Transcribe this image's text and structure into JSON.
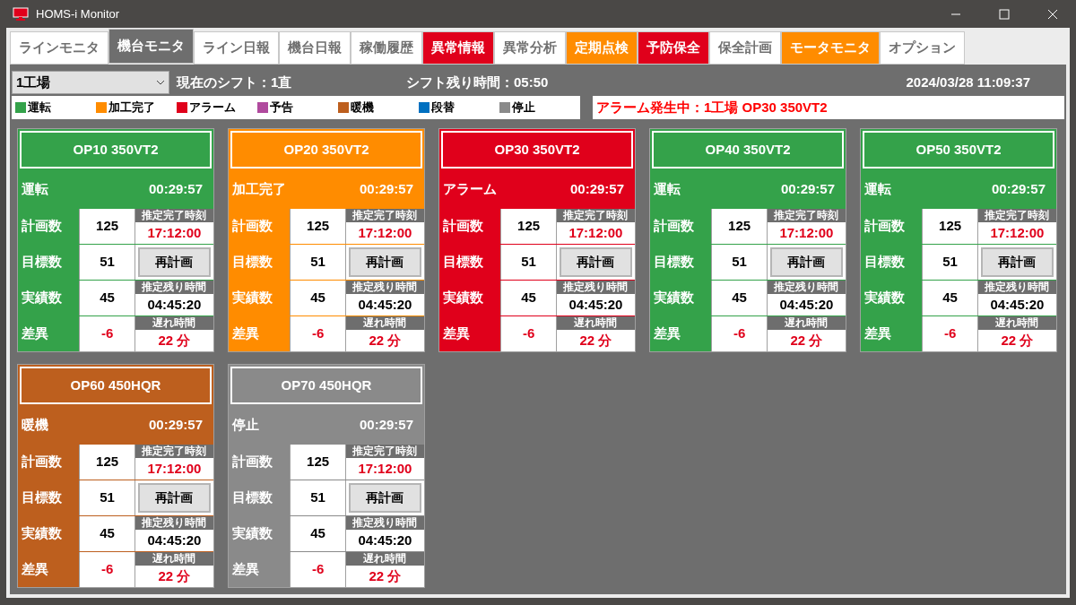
{
  "window": {
    "title": "HOMS-i Monitor"
  },
  "tabs": [
    {
      "label": "ラインモニタ",
      "selected": false,
      "color": "#ffffff"
    },
    {
      "label": "機台モニタ",
      "selected": true,
      "color": "#6e6e6e"
    },
    {
      "label": "ライン日報",
      "selected": false,
      "color": "#ffffff"
    },
    {
      "label": "機台日報",
      "selected": false,
      "color": "#ffffff"
    },
    {
      "label": "稼働履歴",
      "selected": false,
      "color": "#ffffff"
    },
    {
      "label": "異常情報",
      "selected": false,
      "color": "#e0001b"
    },
    {
      "label": "異常分析",
      "selected": false,
      "color": "#ffffff"
    },
    {
      "label": "定期点検",
      "selected": false,
      "color": "#ff8c00"
    },
    {
      "label": "予防保全",
      "selected": false,
      "color": "#e0001b"
    },
    {
      "label": "保全計画",
      "selected": false,
      "color": "#ffffff"
    },
    {
      "label": "モータモニタ",
      "selected": false,
      "color": "#ff8c00"
    },
    {
      "label": "オプション",
      "selected": false,
      "color": "#ffffff"
    }
  ],
  "factory_select": {
    "value": "1工場"
  },
  "shift": "現在のシフト：1直",
  "shift_remaining": "シフト残り時間：05:50",
  "datetime": "2024/03/28 11:09:37",
  "legend": [
    {
      "label": "運転",
      "color": "#34a24a"
    },
    {
      "label": "加工完了",
      "color": "#ff8c00"
    },
    {
      "label": "アラーム",
      "color": "#e0001b"
    },
    {
      "label": "予告",
      "color": "#b04a9e"
    },
    {
      "label": "暖機",
      "color": "#bd5f1e"
    },
    {
      "label": "段替",
      "color": "#0070c0"
    },
    {
      "label": "停止",
      "color": "#8a8a8a"
    }
  ],
  "alarm_message": "アラーム発生中：1工場 OP30 350VT2",
  "machines": [
    {
      "name": "OP10 350VT2",
      "color": "#34a24a",
      "status": "運転",
      "time": "00:29:57",
      "rows": [
        {
          "label": "計画数",
          "value": "125",
          "side": {
            "kind": "info",
            "caption": "推定完了時刻",
            "value": "17:12:00"
          }
        },
        {
          "label": "目標数",
          "value": "51",
          "side": {
            "kind": "button",
            "label": "再計画"
          }
        },
        {
          "label": "実績数",
          "value": "45",
          "side": {
            "kind": "info",
            "caption": "推定残り時間",
            "value": "04:45:20"
          }
        },
        {
          "label": "差異",
          "value": "-6",
          "side": {
            "kind": "info",
            "caption": "遅れ時間",
            "value": "22 分"
          }
        }
      ]
    },
    {
      "name": "OP20 350VT2",
      "color": "#ff8c00",
      "status": "加工完了",
      "time": "00:29:57",
      "rows": [
        {
          "label": "計画数",
          "value": "125",
          "side": {
            "kind": "info",
            "caption": "推定完了時刻",
            "value": "17:12:00"
          }
        },
        {
          "label": "目標数",
          "value": "51",
          "side": {
            "kind": "button",
            "label": "再計画"
          }
        },
        {
          "label": "実績数",
          "value": "45",
          "side": {
            "kind": "info",
            "caption": "推定残り時間",
            "value": "04:45:20"
          }
        },
        {
          "label": "差異",
          "value": "-6",
          "side": {
            "kind": "info",
            "caption": "遅れ時間",
            "value": "22 分"
          }
        }
      ]
    },
    {
      "name": "OP30 350VT2",
      "color": "#e0001b",
      "status": "アラーム",
      "time": "00:29:57",
      "rows": [
        {
          "label": "計画数",
          "value": "125",
          "side": {
            "kind": "info",
            "caption": "推定完了時刻",
            "value": "17:12:00"
          }
        },
        {
          "label": "目標数",
          "value": "51",
          "side": {
            "kind": "button",
            "label": "再計画"
          }
        },
        {
          "label": "実績数",
          "value": "45",
          "side": {
            "kind": "info",
            "caption": "推定残り時間",
            "value": "04:45:20"
          }
        },
        {
          "label": "差異",
          "value": "-6",
          "side": {
            "kind": "info",
            "caption": "遅れ時間",
            "value": "22 分"
          }
        }
      ]
    },
    {
      "name": "OP40 350VT2",
      "color": "#34a24a",
      "status": "運転",
      "time": "00:29:57",
      "rows": [
        {
          "label": "計画数",
          "value": "125",
          "side": {
            "kind": "info",
            "caption": "推定完了時刻",
            "value": "17:12:00"
          }
        },
        {
          "label": "目標数",
          "value": "51",
          "side": {
            "kind": "button",
            "label": "再計画"
          }
        },
        {
          "label": "実績数",
          "value": "45",
          "side": {
            "kind": "info",
            "caption": "推定残り時間",
            "value": "04:45:20"
          }
        },
        {
          "label": "差異",
          "value": "-6",
          "side": {
            "kind": "info",
            "caption": "遅れ時間",
            "value": "22 分"
          }
        }
      ]
    },
    {
      "name": "OP50 350VT2",
      "color": "#34a24a",
      "status": "運転",
      "time": "00:29:57",
      "rows": [
        {
          "label": "計画数",
          "value": "125",
          "side": {
            "kind": "info",
            "caption": "推定完了時刻",
            "value": "17:12:00"
          }
        },
        {
          "label": "目標数",
          "value": "51",
          "side": {
            "kind": "button",
            "label": "再計画"
          }
        },
        {
          "label": "実績数",
          "value": "45",
          "side": {
            "kind": "info",
            "caption": "推定残り時間",
            "value": "04:45:20"
          }
        },
        {
          "label": "差異",
          "value": "-6",
          "side": {
            "kind": "info",
            "caption": "遅れ時間",
            "value": "22 分"
          }
        }
      ]
    },
    {
      "name": "OP60 450HQR",
      "color": "#bd5f1e",
      "status": "暖機",
      "time": "00:29:57",
      "rows": [
        {
          "label": "計画数",
          "value": "125",
          "side": {
            "kind": "info",
            "caption": "推定完了時刻",
            "value": "17:12:00"
          }
        },
        {
          "label": "目標数",
          "value": "51",
          "side": {
            "kind": "button",
            "label": "再計画"
          }
        },
        {
          "label": "実績数",
          "value": "45",
          "side": {
            "kind": "info",
            "caption": "推定残り時間",
            "value": "04:45:20"
          }
        },
        {
          "label": "差異",
          "value": "-6",
          "side": {
            "kind": "info",
            "caption": "遅れ時間",
            "value": "22 分"
          }
        }
      ]
    },
    {
      "name": "OP70 450HQR",
      "color": "#8a8a8a",
      "status": "停止",
      "time": "00:29:57",
      "rows": [
        {
          "label": "計画数",
          "value": "125",
          "side": {
            "kind": "info",
            "caption": "推定完了時刻",
            "value": "17:12:00"
          }
        },
        {
          "label": "目標数",
          "value": "51",
          "side": {
            "kind": "button",
            "label": "再計画"
          }
        },
        {
          "label": "実績数",
          "value": "45",
          "side": {
            "kind": "info",
            "caption": "推定残り時間",
            "value": "04:45:20"
          }
        },
        {
          "label": "差異",
          "value": "-6",
          "side": {
            "kind": "info",
            "caption": "遅れ時間",
            "value": "22 分"
          }
        }
      ]
    }
  ]
}
